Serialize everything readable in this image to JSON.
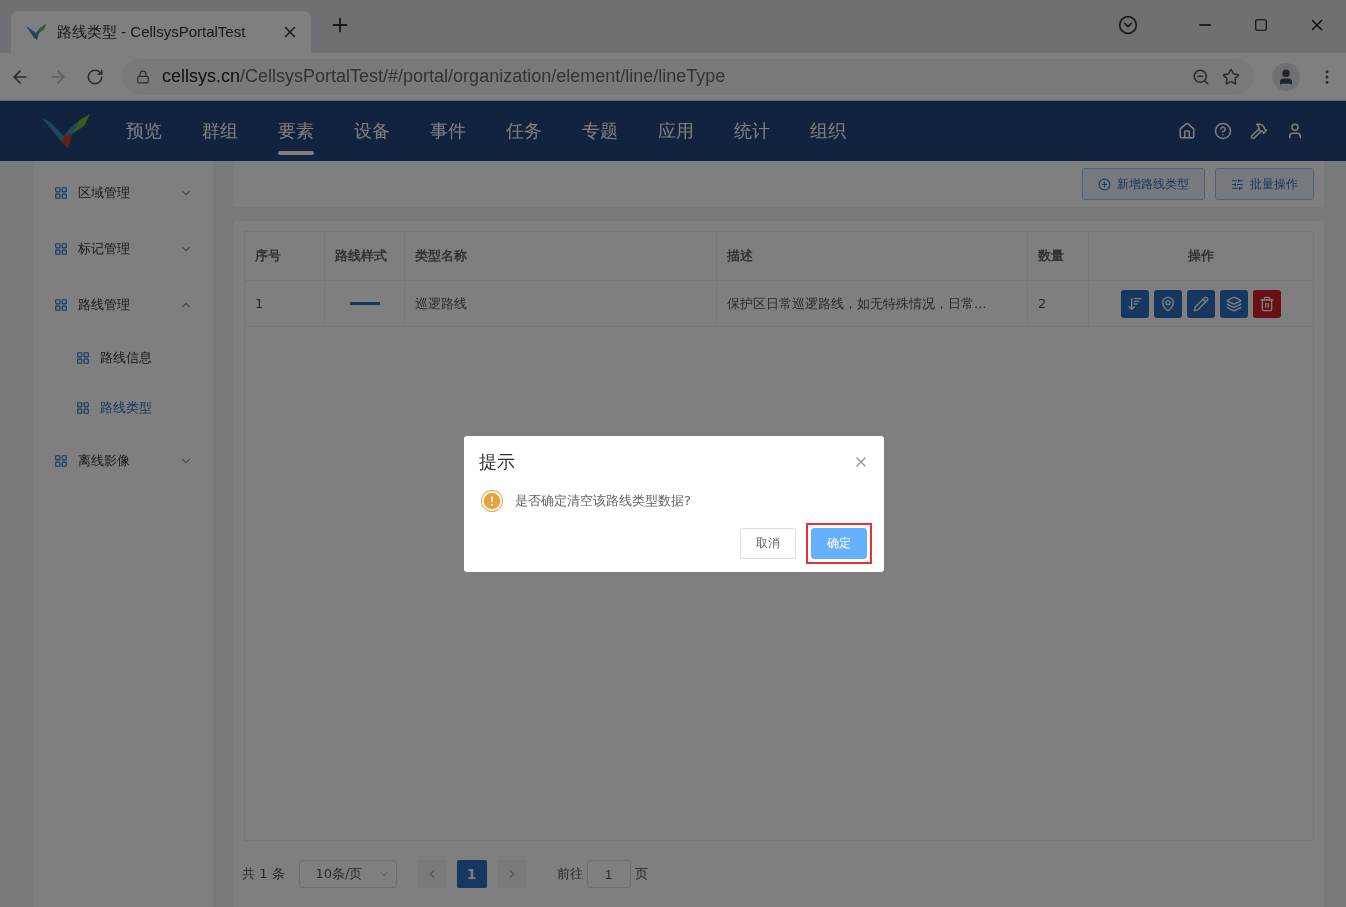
{
  "browser": {
    "tab_title": "路线类型 - CellsysPortalTest",
    "url_host": "cellsys.cn",
    "url_path": "/CellsysPortalTest/#/portal/organization/element/line/lineType"
  },
  "nav": [
    {
      "label": "预览",
      "selected": false
    },
    {
      "label": "群组",
      "selected": false
    },
    {
      "label": "要素",
      "selected": true
    },
    {
      "label": "设备",
      "selected": false
    },
    {
      "label": "事件",
      "selected": false
    },
    {
      "label": "任务",
      "selected": false
    },
    {
      "label": "专题",
      "selected": false
    },
    {
      "label": "应用",
      "selected": false
    },
    {
      "label": "统计",
      "selected": false
    },
    {
      "label": "组织",
      "selected": false
    }
  ],
  "sidebar": [
    {
      "label": "区域管理",
      "expanded": false
    },
    {
      "label": "标记管理",
      "expanded": false
    },
    {
      "label": "路线管理",
      "expanded": true,
      "children": [
        {
          "label": "路线信息",
          "selected": false
        },
        {
          "label": "路线类型",
          "selected": true
        }
      ]
    },
    {
      "label": "离线影像",
      "expanded": false
    }
  ],
  "toolbar": [
    {
      "kind": "add",
      "label": "新增路线类型"
    },
    {
      "kind": "batch",
      "label": "批量操作"
    }
  ],
  "table": {
    "columns": [
      "序号",
      "路线样式",
      "类型名称",
      "描述",
      "数量",
      "操作"
    ],
    "rows": [
      {
        "index": "1",
        "name": "巡逻路线",
        "description": "保护区日常巡逻路线，如无特殊情况，日常...",
        "count": "2",
        "actions": [
          {
            "kind": "sort"
          },
          {
            "kind": "map"
          },
          {
            "kind": "edit"
          },
          {
            "kind": "layers"
          },
          {
            "kind": "delete"
          }
        ]
      }
    ]
  },
  "pagination": {
    "total": "共 1 条",
    "page_size": "10条/页",
    "pages": [
      {
        "label": "1",
        "selected": true
      }
    ],
    "goto_label": "前往",
    "goto_value": "1",
    "goto_suffix": "页"
  },
  "dialog": {
    "title": "提示",
    "message": "是否确定清空该路线类型数据?",
    "buttons": [
      {
        "kind": "cancel",
        "label": "取消",
        "highlighted": false
      },
      {
        "kind": "confirm",
        "label": "确定",
        "highlighted": true
      }
    ]
  }
}
